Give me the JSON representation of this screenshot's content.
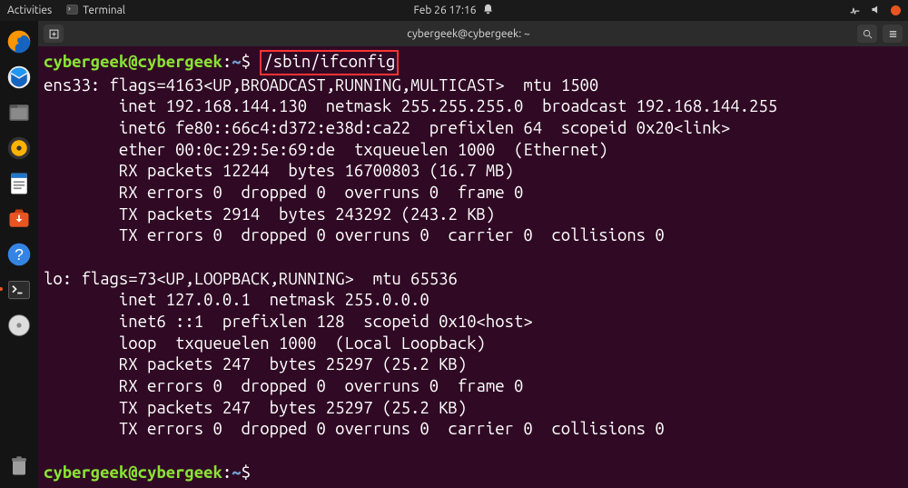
{
  "topbar": {
    "activities": "Activities",
    "app_label": "Terminal",
    "datetime": "Feb 26  17:16"
  },
  "titlebar": {
    "title": "cybergeek@cybergeek: ~"
  },
  "dock": {
    "firefox": "firefox-icon",
    "thunderbird": "thunderbird-icon",
    "files": "files-icon",
    "rhythmbox": "rhythmbox-icon",
    "writer": "writer-icon",
    "software": "software-icon",
    "help": "help-icon",
    "terminal": "terminal-icon",
    "disk": "disk-icon",
    "trash": "trash-icon"
  },
  "prompt": {
    "user": "cybergeek",
    "at": "@",
    "host": "cybergeek",
    "colon": ":",
    "path": "~",
    "dollar": "$"
  },
  "command": "/sbin/ifconfig",
  "output": {
    "l1": "ens33: flags=4163<UP,BROADCAST,RUNNING,MULTICAST>  mtu 1500",
    "l2": "        inet 192.168.144.130  netmask 255.255.255.0  broadcast 192.168.144.255",
    "l3": "        inet6 fe80::66c4:d372:e38d:ca22  prefixlen 64  scopeid 0x20<link>",
    "l4": "        ether 00:0c:29:5e:69:de  txqueuelen 1000  (Ethernet)",
    "l5": "        RX packets 12244  bytes 16700803 (16.7 MB)",
    "l6": "        RX errors 0  dropped 0  overruns 0  frame 0",
    "l7": "        TX packets 2914  bytes 243292 (243.2 KB)",
    "l8": "        TX errors 0  dropped 0 overruns 0  carrier 0  collisions 0",
    "blank1": "",
    "l9": "lo: flags=73<UP,LOOPBACK,RUNNING>  mtu 65536",
    "l10": "        inet 127.0.0.1  netmask 255.0.0.0",
    "l11": "        inet6 ::1  prefixlen 128  scopeid 0x10<host>",
    "l12": "        loop  txqueuelen 1000  (Local Loopback)",
    "l13": "        RX packets 247  bytes 25297 (25.2 KB)",
    "l14": "        RX errors 0  dropped 0  overruns 0  frame 0",
    "l15": "        TX packets 247  bytes 25297 (25.2 KB)",
    "l16": "        TX errors 0  dropped 0 overruns 0  carrier 0  collisions 0",
    "blank2": ""
  }
}
